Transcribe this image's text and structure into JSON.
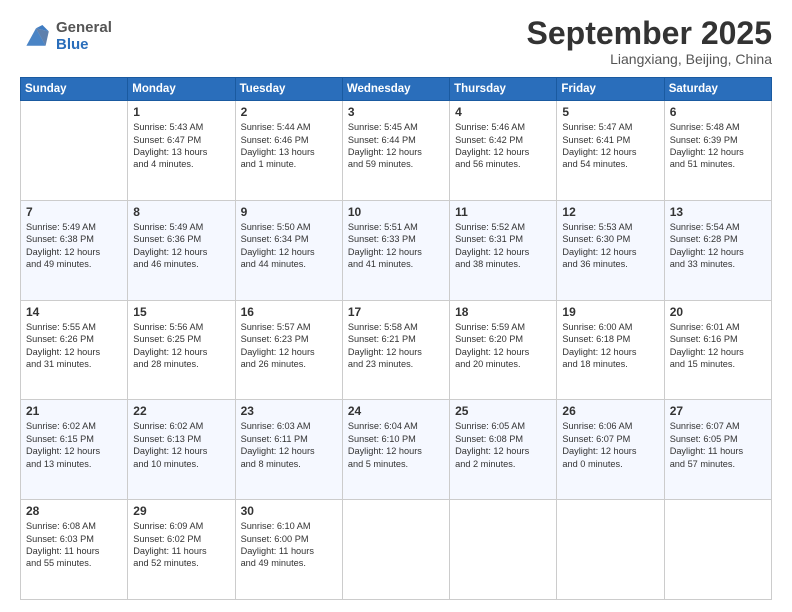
{
  "header": {
    "logo": {
      "line1": "General",
      "line2": "Blue"
    },
    "title": "September 2025",
    "location": "Liangxiang, Beijing, China"
  },
  "days_of_week": [
    "Sunday",
    "Monday",
    "Tuesday",
    "Wednesday",
    "Thursday",
    "Friday",
    "Saturday"
  ],
  "weeks": [
    [
      {
        "num": "",
        "detail": ""
      },
      {
        "num": "1",
        "detail": "Sunrise: 5:43 AM\nSunset: 6:47 PM\nDaylight: 13 hours\nand 4 minutes."
      },
      {
        "num": "2",
        "detail": "Sunrise: 5:44 AM\nSunset: 6:46 PM\nDaylight: 13 hours\nand 1 minute."
      },
      {
        "num": "3",
        "detail": "Sunrise: 5:45 AM\nSunset: 6:44 PM\nDaylight: 12 hours\nand 59 minutes."
      },
      {
        "num": "4",
        "detail": "Sunrise: 5:46 AM\nSunset: 6:42 PM\nDaylight: 12 hours\nand 56 minutes."
      },
      {
        "num": "5",
        "detail": "Sunrise: 5:47 AM\nSunset: 6:41 PM\nDaylight: 12 hours\nand 54 minutes."
      },
      {
        "num": "6",
        "detail": "Sunrise: 5:48 AM\nSunset: 6:39 PM\nDaylight: 12 hours\nand 51 minutes."
      }
    ],
    [
      {
        "num": "7",
        "detail": "Sunrise: 5:49 AM\nSunset: 6:38 PM\nDaylight: 12 hours\nand 49 minutes."
      },
      {
        "num": "8",
        "detail": "Sunrise: 5:49 AM\nSunset: 6:36 PM\nDaylight: 12 hours\nand 46 minutes."
      },
      {
        "num": "9",
        "detail": "Sunrise: 5:50 AM\nSunset: 6:34 PM\nDaylight: 12 hours\nand 44 minutes."
      },
      {
        "num": "10",
        "detail": "Sunrise: 5:51 AM\nSunset: 6:33 PM\nDaylight: 12 hours\nand 41 minutes."
      },
      {
        "num": "11",
        "detail": "Sunrise: 5:52 AM\nSunset: 6:31 PM\nDaylight: 12 hours\nand 38 minutes."
      },
      {
        "num": "12",
        "detail": "Sunrise: 5:53 AM\nSunset: 6:30 PM\nDaylight: 12 hours\nand 36 minutes."
      },
      {
        "num": "13",
        "detail": "Sunrise: 5:54 AM\nSunset: 6:28 PM\nDaylight: 12 hours\nand 33 minutes."
      }
    ],
    [
      {
        "num": "14",
        "detail": "Sunrise: 5:55 AM\nSunset: 6:26 PM\nDaylight: 12 hours\nand 31 minutes."
      },
      {
        "num": "15",
        "detail": "Sunrise: 5:56 AM\nSunset: 6:25 PM\nDaylight: 12 hours\nand 28 minutes."
      },
      {
        "num": "16",
        "detail": "Sunrise: 5:57 AM\nSunset: 6:23 PM\nDaylight: 12 hours\nand 26 minutes."
      },
      {
        "num": "17",
        "detail": "Sunrise: 5:58 AM\nSunset: 6:21 PM\nDaylight: 12 hours\nand 23 minutes."
      },
      {
        "num": "18",
        "detail": "Sunrise: 5:59 AM\nSunset: 6:20 PM\nDaylight: 12 hours\nand 20 minutes."
      },
      {
        "num": "19",
        "detail": "Sunrise: 6:00 AM\nSunset: 6:18 PM\nDaylight: 12 hours\nand 18 minutes."
      },
      {
        "num": "20",
        "detail": "Sunrise: 6:01 AM\nSunset: 6:16 PM\nDaylight: 12 hours\nand 15 minutes."
      }
    ],
    [
      {
        "num": "21",
        "detail": "Sunrise: 6:02 AM\nSunset: 6:15 PM\nDaylight: 12 hours\nand 13 minutes."
      },
      {
        "num": "22",
        "detail": "Sunrise: 6:02 AM\nSunset: 6:13 PM\nDaylight: 12 hours\nand 10 minutes."
      },
      {
        "num": "23",
        "detail": "Sunrise: 6:03 AM\nSunset: 6:11 PM\nDaylight: 12 hours\nand 8 minutes."
      },
      {
        "num": "24",
        "detail": "Sunrise: 6:04 AM\nSunset: 6:10 PM\nDaylight: 12 hours\nand 5 minutes."
      },
      {
        "num": "25",
        "detail": "Sunrise: 6:05 AM\nSunset: 6:08 PM\nDaylight: 12 hours\nand 2 minutes."
      },
      {
        "num": "26",
        "detail": "Sunrise: 6:06 AM\nSunset: 6:07 PM\nDaylight: 12 hours\nand 0 minutes."
      },
      {
        "num": "27",
        "detail": "Sunrise: 6:07 AM\nSunset: 6:05 PM\nDaylight: 11 hours\nand 57 minutes."
      }
    ],
    [
      {
        "num": "28",
        "detail": "Sunrise: 6:08 AM\nSunset: 6:03 PM\nDaylight: 11 hours\nand 55 minutes."
      },
      {
        "num": "29",
        "detail": "Sunrise: 6:09 AM\nSunset: 6:02 PM\nDaylight: 11 hours\nand 52 minutes."
      },
      {
        "num": "30",
        "detail": "Sunrise: 6:10 AM\nSunset: 6:00 PM\nDaylight: 11 hours\nand 49 minutes."
      },
      {
        "num": "",
        "detail": ""
      },
      {
        "num": "",
        "detail": ""
      },
      {
        "num": "",
        "detail": ""
      },
      {
        "num": "",
        "detail": ""
      }
    ]
  ]
}
